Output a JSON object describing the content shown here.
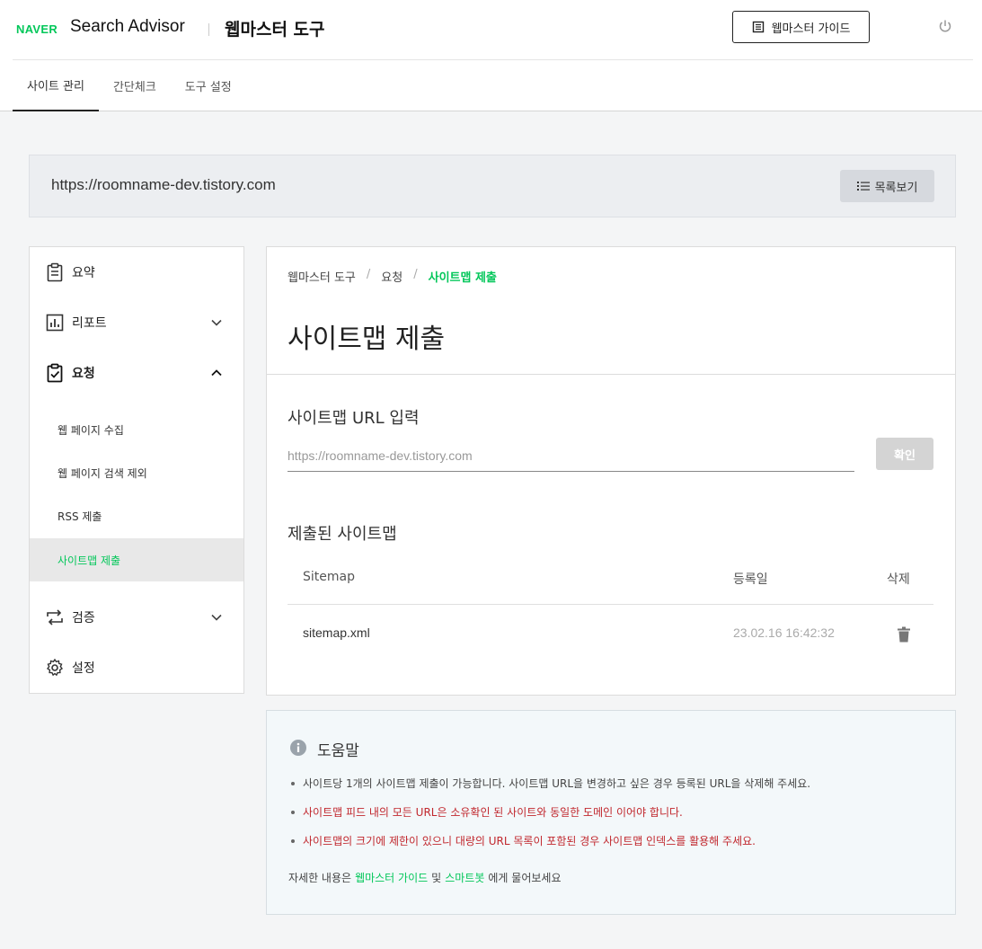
{
  "header": {
    "logo": "NAVER",
    "brand": "Search Advisor",
    "tool_title": "웹마스터 도구",
    "guide_button": "웹마스터 가이드"
  },
  "tabs": [
    {
      "label": "사이트 관리",
      "active": true
    },
    {
      "label": "간단체크",
      "active": false
    },
    {
      "label": "도구 설정",
      "active": false
    }
  ],
  "site": {
    "url": "https://roomname-dev.tistory.com",
    "list_button": "목록보기"
  },
  "sidebar": {
    "items": [
      {
        "label": "요약",
        "icon": "clipboard-icon"
      },
      {
        "label": "리포트",
        "icon": "chart-icon",
        "expanded": false
      },
      {
        "label": "요청",
        "icon": "clipboard-check-icon",
        "expanded": true
      },
      {
        "label": "검증",
        "icon": "repeat-icon",
        "expanded": false
      },
      {
        "label": "설정",
        "icon": "gear-icon"
      }
    ],
    "sub_items": [
      {
        "label": "웹 페이지 수집"
      },
      {
        "label": "웹 페이지 검색 제외"
      },
      {
        "label": "RSS 제출"
      },
      {
        "label": "사이트맵 제출",
        "active": true
      }
    ]
  },
  "main": {
    "breadcrumb": [
      "웹마스터 도구",
      "요청",
      "사이트맵 제출"
    ],
    "page_title": "사이트맵 제출",
    "input_section_title": "사이트맵 URL 입력",
    "input_placeholder": "https://roomname-dev.tistory.com",
    "confirm_button": "확인",
    "list_section_title": "제출된 사이트맵",
    "table": {
      "headers": [
        "Sitemap",
        "등록일",
        "삭제"
      ],
      "rows": [
        {
          "sitemap": "sitemap.xml",
          "date": "23.02.16 16:42:32"
        }
      ]
    }
  },
  "help": {
    "title": "도움말",
    "items": [
      {
        "text": "사이트당 1개의 사이트맵 제출이 가능합니다. 사이트맵 URL을 변경하고 싶은 경우 등록된 URL을 삭제해 주세요.",
        "warn": false
      },
      {
        "text": "사이트맵 피드 내의 모든 URL은 소유확인 된 사이트와 동일한 도메인 이어야 합니다.",
        "warn": true
      },
      {
        "text": "사이트맵의 크기에 제한이 있으니 대량의 URL 목록이 포함된 경우 사이트맵 인덱스를 활용해 주세요.",
        "warn": true
      }
    ],
    "footer_prefix": "자세한 내용은",
    "footer_link1": "웹마스터 가이드",
    "footer_and": "및",
    "footer_link2": "스마트봇",
    "footer_suffix": "에게 물어보세요"
  },
  "colors": {
    "accent": "#03c75a",
    "warning": "#c1272d"
  }
}
